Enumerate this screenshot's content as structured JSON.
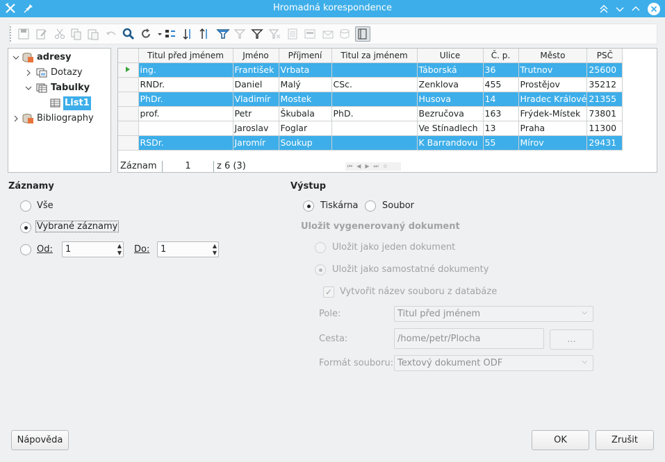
{
  "window": {
    "title": "Hromadná korespondence"
  },
  "tree": {
    "items": [
      {
        "label": "adresy"
      },
      {
        "label": "Dotazy"
      },
      {
        "label": "Tabulky"
      },
      {
        "label": "List1"
      },
      {
        "label": "Bibliography"
      }
    ]
  },
  "grid": {
    "columns": [
      "Titul před jménem",
      "Jméno",
      "Příjmení",
      "Titul za jménem",
      "Ulice",
      "Č. p.",
      "Město",
      "PSČ"
    ],
    "rows": [
      {
        "selected": true,
        "current": true,
        "cells": [
          "ing.",
          "František",
          "Vrbata",
          "",
          "Táborská",
          "36",
          "Trutnov",
          "25600"
        ]
      },
      {
        "selected": false,
        "current": false,
        "cells": [
          "RNDr.",
          "Daniel",
          "Malý",
          "CSc.",
          "Zenklova",
          "455",
          "Prostějov",
          "35212"
        ]
      },
      {
        "selected": true,
        "current": false,
        "cells": [
          "PhDr.",
          "Vladimír",
          "Mostek",
          "",
          "Husova",
          "14",
          "Hradec Králové",
          "21355"
        ]
      },
      {
        "selected": false,
        "current": false,
        "cells": [
          "prof.",
          "Petr",
          "Škubala",
          "PhD.",
          "Bezručova",
          "163",
          "Frýdek-Místek",
          "73801"
        ]
      },
      {
        "selected": false,
        "current": false,
        "cells": [
          "",
          "Jaroslav",
          "Foglar",
          "",
          "Ve Stínadlech",
          "13",
          "Praha",
          "11300"
        ]
      },
      {
        "selected": true,
        "current": false,
        "cells": [
          "RSDr.",
          "Jaromír",
          "Soukup",
          "",
          "K Barrandovu",
          "55",
          "Mírov",
          "29431"
        ]
      }
    ],
    "nav": {
      "label": "Záznam",
      "current": "1",
      "of": "z 6 (3)"
    }
  },
  "records": {
    "title": "Záznamy",
    "all_label": "Vše",
    "selected_label": "Vybrané záznamy",
    "from_label": "Od:",
    "from_value": "1",
    "to_label": "Do:",
    "to_value": "1",
    "selected_option": "selected"
  },
  "output": {
    "title": "Výstup",
    "printer_label": "Tiskárna",
    "file_label": "Soubor",
    "selected_option": "printer",
    "save_title": "Uložit vygenerovaný dokument",
    "save_single_label": "Uložit jako jeden dokument",
    "save_separate_label": "Uložit jako samostatné dokumenty",
    "generate_name_label": "Vytvořit název souboru z databáze",
    "field_label": "Pole:",
    "field_value": "Titul před jménem",
    "path_label": "Cesta:",
    "path_value": "/home/petr/Plocha",
    "browse_label": "...",
    "format_label": "Formát souboru:",
    "format_value": "Textový dokument ODF"
  },
  "buttons": {
    "help": "Nápověda",
    "ok": "OK",
    "cancel": "Zrušit"
  },
  "colors": {
    "accent": "#3daee9"
  }
}
